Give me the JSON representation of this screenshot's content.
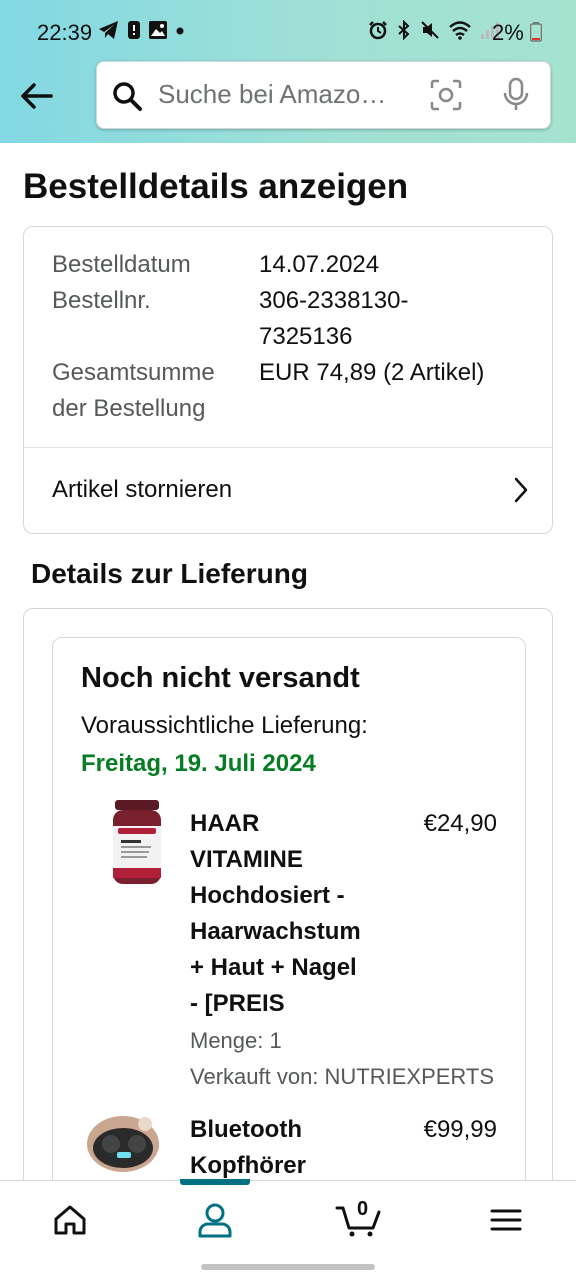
{
  "status_bar": {
    "time": "22:39",
    "battery": "2%"
  },
  "search": {
    "placeholder": "Suche bei Amazo…"
  },
  "page_title": "Bestelldetails anzeigen",
  "order": {
    "date_label": "Bestelldatum",
    "date": "14.07.2024",
    "number_label": "Bestellnr.",
    "number_line1": "306-2338130-",
    "number_line2": "7325136",
    "total_label_line1": "Gesamtsumme",
    "total_label_line2": "der Bestellung",
    "total": "EUR 74,89 (2 Artikel)",
    "cancel_label": "Artikel stornieren"
  },
  "delivery": {
    "heading": "Details zur Lieferung",
    "status": "Noch nicht versandt",
    "eta_label": "Voraussichtliche Lieferung:",
    "eta_date": "Freitag, 19. Juli 2024",
    "items": [
      {
        "name_lines": [
          "HAAR",
          "VITAMINE",
          "Hochdosiert -",
          "Haarwachstum",
          "+ Haut + Nagel",
          "- [PREIS"
        ],
        "price": "€24,90",
        "qty": "Menge: 1",
        "seller": "Verkauft von: NUTRIEXPERTS",
        "thumb_text": "NUTRALE"
      },
      {
        "name_lines": [
          "Bluetooth",
          "Kopfhörer"
        ],
        "price": "€99,99"
      }
    ]
  },
  "nav": {
    "cart_count": "0"
  },
  "colors": {
    "accent": "#007185",
    "eta": "#067d22",
    "header_start": "#82d8e3",
    "header_end": "#a6e3cf"
  }
}
